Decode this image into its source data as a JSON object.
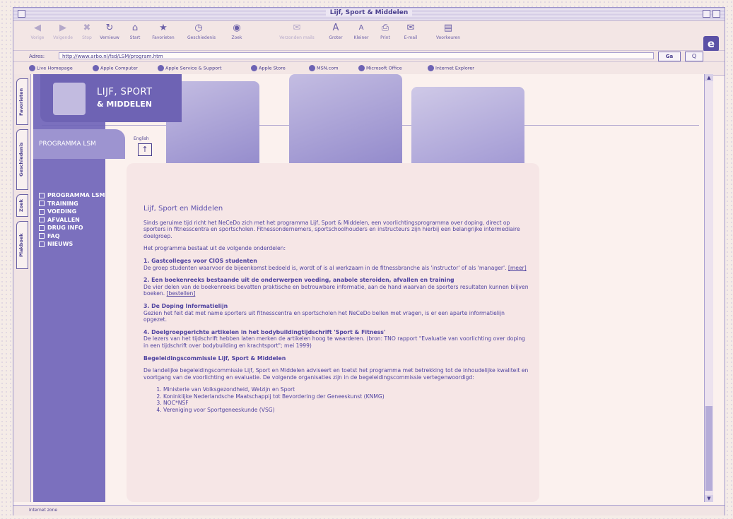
{
  "window": {
    "title": "Lijf, Sport & Middelen"
  },
  "toolbar": {
    "buttons": [
      "Vorige",
      "Volgende",
      "Stop",
      "Vernieuw",
      "Start",
      "Favorieten",
      "Geschiedenis",
      "Zoek",
      "Verzonden mails",
      "Groter",
      "Kleiner",
      "Print",
      "E-mail",
      "Voorkeuren"
    ]
  },
  "address": {
    "label": "Adres:",
    "url": "http://www.arbo.nl/fsd/LSM/program.htm",
    "go": "Ga",
    "search": "Q"
  },
  "favorites": [
    "Live Homepage",
    "Apple Computer",
    "Apple Service & Support",
    "Apple Store",
    "MSN.com",
    "Microsoft Office",
    "Internet Explorer"
  ],
  "side_tabs": [
    "Favorieten",
    "Geschiedenis",
    "Zoek",
    "Plakboek"
  ],
  "brand": {
    "line1": "LIJF, SPORT",
    "line2": "& MIDDELEN"
  },
  "section_tab": "PROGRAMMA LSM",
  "menu": [
    "PROGRAMMA LSM",
    "TRAINING",
    "VOEDING",
    "AFVALLEN",
    "DRUG INFO",
    "FAQ",
    "NIEUWS"
  ],
  "english": "English",
  "article": {
    "heading": "Lijf, Sport en Middelen",
    "intro": "Sinds geruime tijd richt het NeCeDo zich met het programma Lijf, Sport & Middelen, een voorlichtingsprogramma over doping, direct op sporters in fitnesscentra en sportscholen. Fitnessondernemers, sportschoolhouders en instructeurs zijn hierbij een belangrijke intermediaire doelgroep.",
    "lead": "Het programma bestaat uit de volgende onderdelen:",
    "items": [
      {
        "title": "1. Gastcolleges voor CIOS studenten",
        "body": "De groep studenten waarvoor de bijeenkomst bedoeld is, wordt of is al werkzaam in de fitnessbranche als 'instructor' of als 'manager'.",
        "link": "[meer]"
      },
      {
        "title": "2. Een boekenreeks bestaande uit de onderwerpen voeding, anabole steroiden, afvallen en training",
        "body": "De vier delen van de boekenreeks bevatten praktische en betrouwbare informatie, aan de hand waarvan de sporters resultaten kunnen blijven boeken.",
        "link": "[bestellen]"
      },
      {
        "title": "3. De Doping Informatielijn",
        "body": "Gezien het feit dat met name sporters uit fitnesscentra en sportscholen het NeCeDo bellen met vragen, is er een aparte informatielijn opgezet.",
        "link": ""
      },
      {
        "title": "4. Doelgroepgerichte artikelen in het bodybuildingtijdschrift 'Sport & Fitness'",
        "body": "De lezers van het tijdschrift hebben laten merken de artikelen hoog te waarderen. (bron: TNO rapport \"Evaluatie van voorlichting over doping in een tijdschrift over bodybuilding en krachtsport\"; mei 1999)",
        "link": ""
      }
    ],
    "commission_title": "Begeleidingscommissie Lijf, Sport & Middelen",
    "commission_body": "De landelijke begeleidingscommissie Lijf, Sport en Middelen adviseert en toetst het programma met betrekking tot de inhoudelijke kwaliteit en voortgang van de voorlichting en evaluatie. De volgende organisaties zijn in de begeleidingscommissie vertegenwoordigd:",
    "orgs": [
      "Ministerie van Volksgezondheid, Welzijn en Sport",
      "Koninklijke Nederlandsche Maatschappij tot Bevordering der Geneeskunst (KNMG)",
      "NOC*NSF",
      "Vereniging voor Sportgeneeskunde (VSG)"
    ]
  },
  "status": "Internet zone"
}
